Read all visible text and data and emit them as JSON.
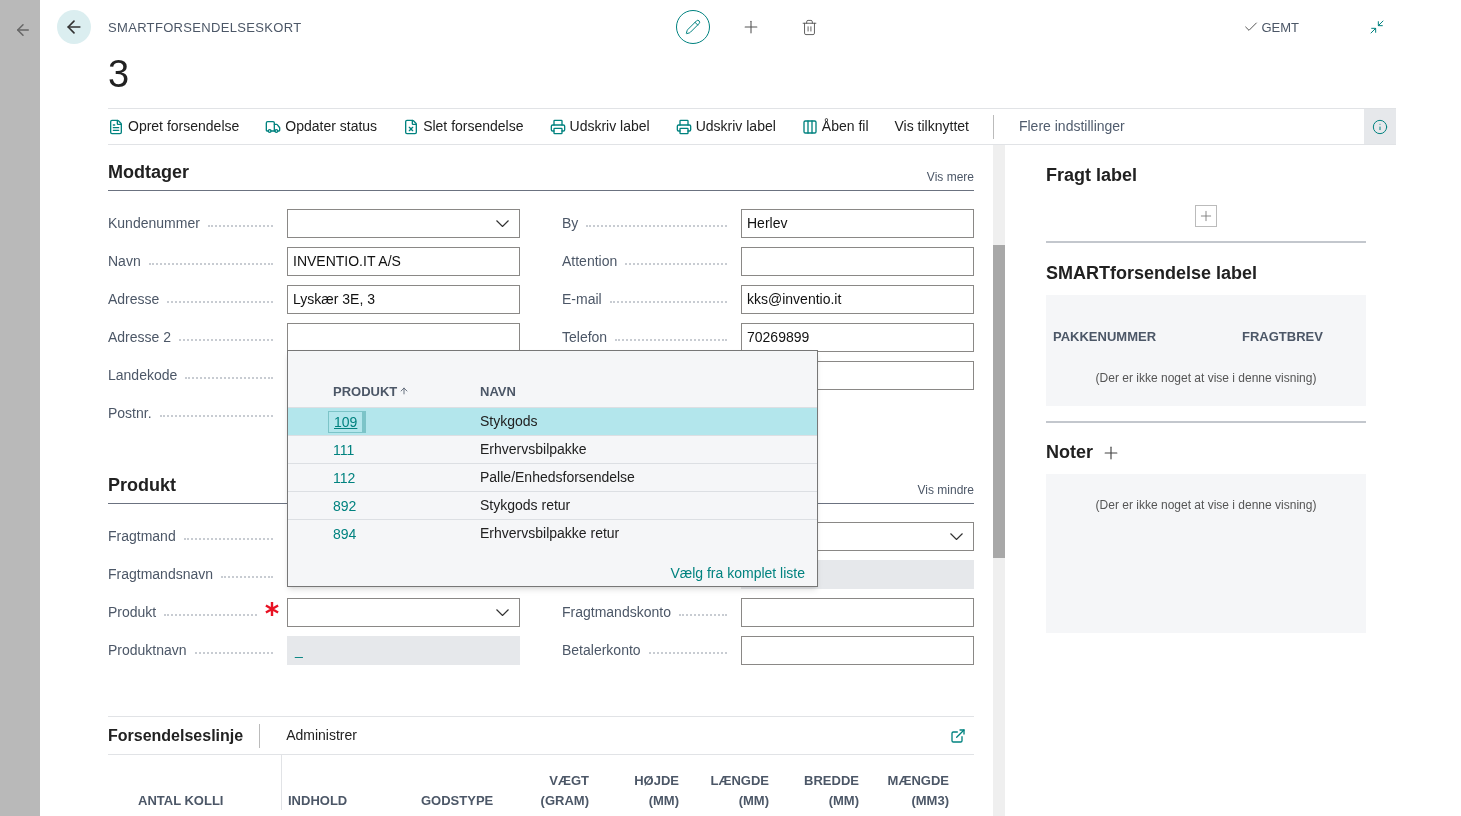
{
  "header": {
    "caption": "SMARTFORSENDELSESKORT",
    "record_number": "3",
    "save_status": "GEMT"
  },
  "actions": [
    {
      "label": "Opret forsendelse",
      "kind": "icon"
    },
    {
      "label": "Opdater status",
      "kind": "icon"
    },
    {
      "label": "Slet forsendelse",
      "kind": "icon"
    },
    {
      "label": "Udskriv label",
      "kind": "icon"
    },
    {
      "label": "Udskriv label",
      "kind": "icon"
    },
    {
      "label": "Åben fil",
      "kind": "icon"
    },
    {
      "label": "Vis tilknyttet",
      "kind": "text"
    }
  ],
  "more_options": "Flere indstillinger",
  "recipient": {
    "title": "Modtager",
    "toggle": "Vis mere",
    "left": [
      {
        "label": "Kundenummer",
        "kind": "dropdown",
        "required": false
      },
      {
        "label": "Navn",
        "kind": "text",
        "value": "INVENTIO.IT A/S",
        "required": false
      },
      {
        "label": "Adresse",
        "kind": "text",
        "value": "Lyskær 3E, 3",
        "required": false
      },
      {
        "label": "Adresse 2",
        "kind": "text",
        "required": false
      },
      {
        "label": "Landekode",
        "kind": "covered",
        "required": false
      },
      {
        "label": "Postnr.",
        "kind": "covered",
        "required": false
      }
    ],
    "right": [
      {
        "label": "By",
        "kind": "text",
        "value": "Herlev",
        "required": false
      },
      {
        "label": "Attention",
        "kind": "text",
        "required": false
      },
      {
        "label": "E-mail",
        "kind": "text",
        "value": "kks@inventio.it",
        "required": false
      },
      {
        "label": "Telefon",
        "kind": "text",
        "value": "70269899",
        "required": false
      },
      {
        "kind": "text"
      }
    ]
  },
  "product": {
    "title": "Produkt",
    "toggle": "Vis mindre",
    "left": [
      {
        "label": "Fragtmand",
        "kind": "covered",
        "required": false
      },
      {
        "label": "Fragtmandsnavn",
        "kind": "covered",
        "required": false
      },
      {
        "label": "Produkt",
        "kind": "dropdown",
        "required": true
      },
      {
        "label": "Produktnavn",
        "kind": "readonly",
        "value": "_",
        "required": false
      }
    ],
    "right": [
      {
        "kind": "dropdown"
      },
      {
        "kind": "readonly"
      },
      {
        "label": "Fragtmandskonto",
        "kind": "text",
        "required": false
      },
      {
        "label": "Betalerkonto",
        "kind": "text",
        "required": false
      }
    ]
  },
  "lookup": {
    "columns": [
      "PRODUKT",
      "NAVN"
    ],
    "rows": [
      {
        "code": "109",
        "name": "Stykgods",
        "selected": true
      },
      {
        "code": "111",
        "name": "Erhvervsbilpakke",
        "selected": false
      },
      {
        "code": "112",
        "name": "Palle/Enhedsforsendelse",
        "selected": false
      },
      {
        "code": "892",
        "name": "Stykgods retur",
        "selected": false
      },
      {
        "code": "894",
        "name": "Erhvervsbilpakke retur",
        "selected": false
      }
    ],
    "footer_link": "Vælg fra komplet liste"
  },
  "lines": {
    "title": "Forsendelseslinje",
    "action": "Administrer",
    "columns": [
      {
        "label": "ANTAL KOLLI",
        "kind": "text"
      },
      {
        "label": "INDHOLD",
        "kind": "text"
      },
      {
        "label": "GODSTYPE",
        "kind": "text"
      },
      {
        "label": "VÆGT (GRAM)",
        "kind": "number"
      },
      {
        "label": "HØJDE (MM)",
        "kind": "number"
      },
      {
        "label": "LÆNGDE (MM)",
        "kind": "number"
      },
      {
        "label": "BREDDE (MM)",
        "kind": "number"
      },
      {
        "label": "MÆNGDE (MM3)",
        "kind": "number"
      }
    ]
  },
  "factbox": {
    "freight_label": {
      "title": "Fragt label"
    },
    "smart_label": {
      "title": "SMARTforsendelse label",
      "columns": [
        "PAKKENUMMER",
        "FRAGTBREV"
      ],
      "empty_text": "(Der er ikke noget at vise i denne visning)"
    },
    "notes": {
      "title": "Noter",
      "empty_text": "(Der er ikke noget at vise i denne visning)"
    }
  }
}
